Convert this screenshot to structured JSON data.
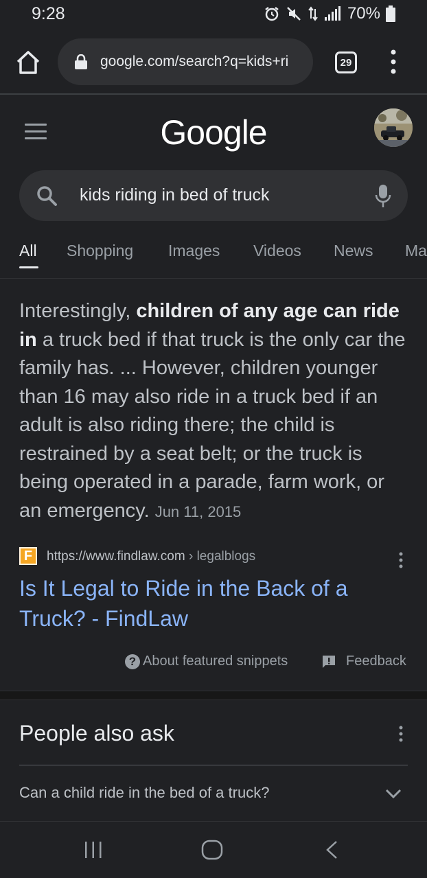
{
  "status_bar": {
    "time": "9:28",
    "battery": "70%"
  },
  "browser": {
    "url": "google.com/search?q=kids+ri",
    "tab_count": "29"
  },
  "google": {
    "logo": "Google",
    "search_query": "kids riding in bed of truck"
  },
  "tabs": [
    {
      "label": "All",
      "active": true
    },
    {
      "label": "Shopping"
    },
    {
      "label": "Images"
    },
    {
      "label": "Videos"
    },
    {
      "label": "News"
    },
    {
      "label": "Ma"
    }
  ],
  "snippet": {
    "text_1": "Interestingly, ",
    "bold": "children of any age can ride in",
    "text_2": " a truck bed if that truck is the only car the family has. ... However, children younger than 16 may also ride in a truck bed if an adult is also riding there; the child is restrained by a seat belt; or the truck is being operated in a parade, farm work, or an emergency.",
    "date": "Jun 11, 2015",
    "favicon_letter": "F",
    "source_url": "https://www.findlaw.com",
    "source_crumb": "› legalblogs",
    "title": "Is It Legal to Ride in the Back of a Truck? - FindLaw",
    "about_label": "About featured snippets",
    "feedback_label": "Feedback"
  },
  "people_also_ask": {
    "title": "People also ask",
    "questions": [
      "Can a child ride in the bed of a truck?"
    ]
  },
  "colors": {
    "background": "#202124",
    "link": "#8ab4f8",
    "text_primary": "#e8eaed",
    "text_secondary": "#bdc1c6",
    "favicon": "#f5a623"
  }
}
